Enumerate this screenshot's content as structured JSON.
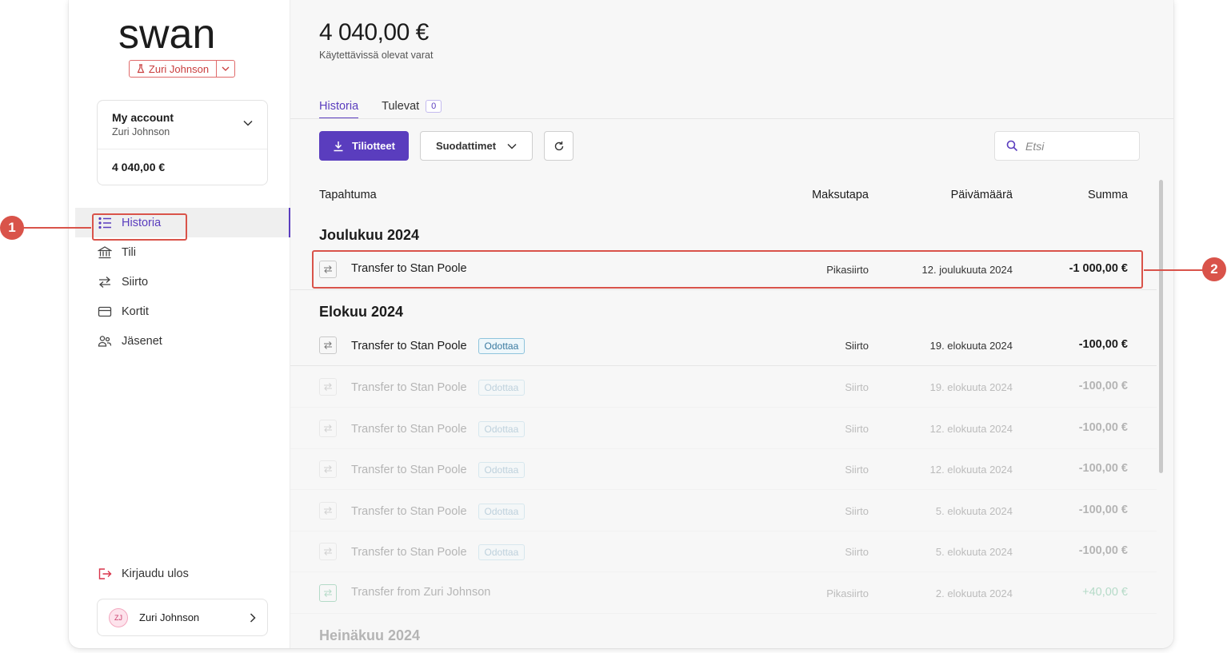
{
  "brand": {
    "logo_text": "swan"
  },
  "switcher": {
    "name": "Zuri Johnson"
  },
  "account": {
    "title": "My account",
    "holder": "Zuri Johnson",
    "balance": "4 040,00 €"
  },
  "nav": {
    "items": [
      {
        "label": "Historia",
        "icon": "list-icon",
        "active": true
      },
      {
        "label": "Tili",
        "icon": "bank-icon"
      },
      {
        "label": "Siirto",
        "icon": "transfer-arrows-icon"
      },
      {
        "label": "Kortit",
        "icon": "card-icon"
      },
      {
        "label": "Jäsenet",
        "icon": "members-icon"
      }
    ],
    "logout": "Kirjaudu ulos"
  },
  "user": {
    "initials": "ZJ",
    "name": "Zuri Johnson"
  },
  "header": {
    "balance": "4 040,00 €",
    "balance_label": "Käytettävissä olevat varat"
  },
  "tabs": [
    {
      "label": "Historia",
      "active": true
    },
    {
      "label": "Tulevat",
      "count": "0"
    }
  ],
  "toolbar": {
    "statements": "Tiliotteet",
    "filters": "Suodattimet",
    "search_placeholder": "Etsi"
  },
  "table": {
    "headers": {
      "event": "Tapahtuma",
      "method": "Maksutapa",
      "date": "Päivämäärä",
      "amount": "Summa"
    },
    "sections": [
      {
        "title": "Joulukuu 2024"
      },
      {
        "title": "Elokuu 2024"
      },
      {
        "title": "Heinäkuu 2024"
      }
    ],
    "rows": [
      {
        "label": "Transfer to Stan Poole",
        "badge": "",
        "method": "Pikasiirto",
        "date": "12. joulukuuta 2024",
        "amount": "-1 000,00 €"
      },
      {
        "label": "Transfer to Stan Poole",
        "badge": "Odottaa",
        "method": "Siirto",
        "date": "19. elokuuta 2024",
        "amount": "-100,00 €"
      },
      {
        "label": "Transfer to Stan Poole",
        "badge": "Odottaa",
        "method": "Siirto",
        "date": "19. elokuuta 2024",
        "amount": "-100,00 €"
      },
      {
        "label": "Transfer to Stan Poole",
        "badge": "Odottaa",
        "method": "Siirto",
        "date": "12. elokuuta 2024",
        "amount": "-100,00 €"
      },
      {
        "label": "Transfer to Stan Poole",
        "badge": "Odottaa",
        "method": "Siirto",
        "date": "12. elokuuta 2024",
        "amount": "-100,00 €"
      },
      {
        "label": "Transfer to Stan Poole",
        "badge": "Odottaa",
        "method": "Siirto",
        "date": "5. elokuuta 2024",
        "amount": "-100,00 €"
      },
      {
        "label": "Transfer to Stan Poole",
        "badge": "Odottaa",
        "method": "Siirto",
        "date": "5. elokuuta 2024",
        "amount": "-100,00 €"
      },
      {
        "label": "Transfer from Zuri Johnson",
        "badge": "",
        "method": "Pikasiirto",
        "date": "2. elokuuta 2024",
        "amount": "+40,00 €"
      }
    ]
  },
  "callouts": {
    "one": "1",
    "two": "2"
  },
  "colors": {
    "accent": "#5a3dbe",
    "callout": "#d9534a",
    "switcher": "#c93d3d",
    "positive": "#1e9b5c"
  }
}
